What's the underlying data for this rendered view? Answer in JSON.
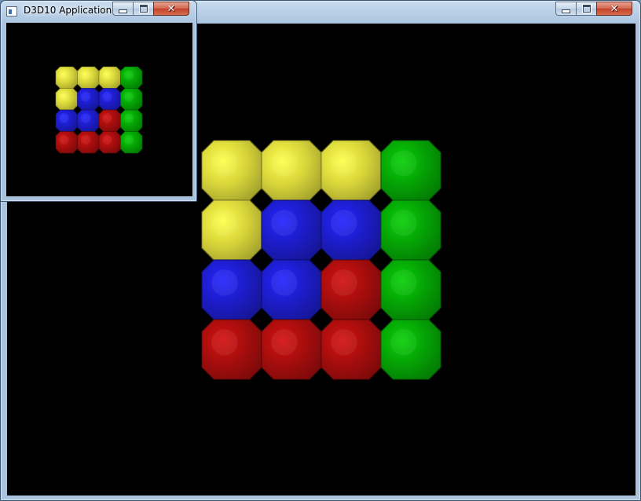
{
  "main_window": {
    "title": "",
    "controls": {
      "minimize": "minimize",
      "maximize": "maximize",
      "close": "close"
    },
    "viewport_clear_color": "#000000"
  },
  "child_window": {
    "title": "D3D10 Application",
    "controls": {
      "minimize": "minimize",
      "maximize": "maximize",
      "close": "close"
    },
    "viewport_clear_color": "#000000"
  },
  "scene": {
    "description": "4x4 tile puzzle rendered in Direct3D 10",
    "colors": {
      "yellow": "#d6d33a",
      "blue": "#1c1cc4",
      "red": "#a30d0d",
      "green": "#05a005"
    },
    "grid": [
      [
        "yellow",
        "yellow",
        "yellow",
        "green"
      ],
      [
        "yellow",
        "blue",
        "blue",
        "green"
      ],
      [
        "blue",
        "blue",
        "red",
        "green"
      ],
      [
        "red",
        "red",
        "red",
        "green"
      ]
    ]
  },
  "icons": {
    "app": "window-app-icon",
    "min": "minimize-icon",
    "max": "maximize-icon",
    "close": "close-icon"
  }
}
